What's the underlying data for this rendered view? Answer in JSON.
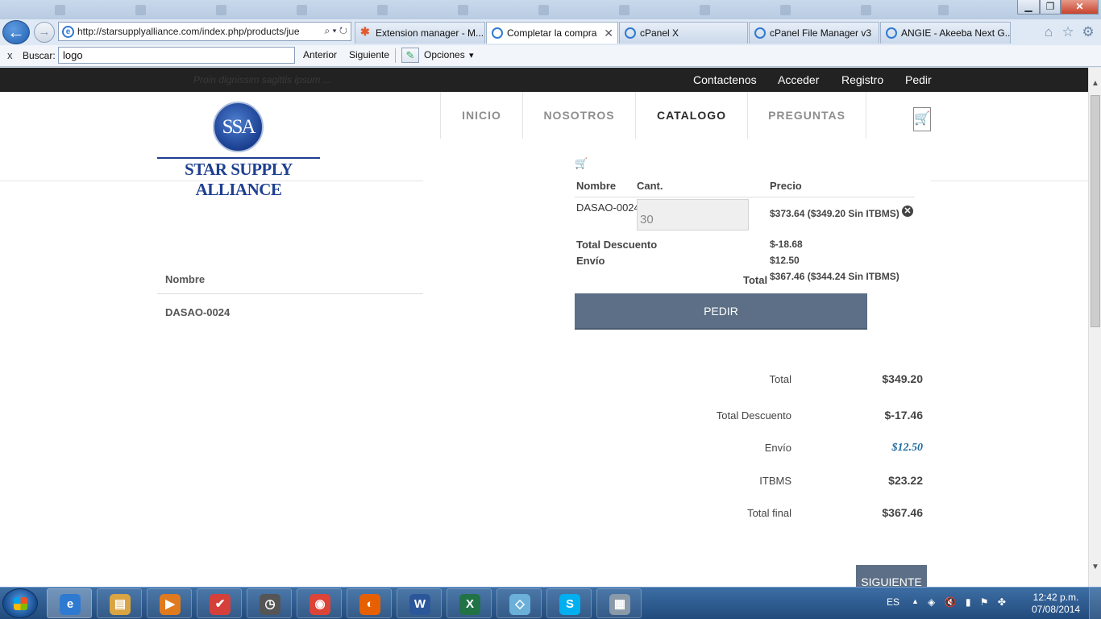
{
  "browser": {
    "address_url": "http://starsupplyalliance.com/index.php/products/jue",
    "address_tools": "⌕ ▾ ↻",
    "tabs": [
      {
        "label": "Extension manager - M...",
        "active": false
      },
      {
        "label": "Completar la compra",
        "active": true
      },
      {
        "label": "cPanel X",
        "active": false
      },
      {
        "label": "cPanel File Manager v3",
        "active": false
      },
      {
        "label": "ANGIE - Akeeba Next G...",
        "active": false
      }
    ],
    "window_buttons": {
      "minimize": "▁",
      "maximize": "❐",
      "close": "✕"
    },
    "toolbar_icons": {
      "home": "⌂",
      "favorites": "☆",
      "settings": "⚙"
    }
  },
  "findbar": {
    "close": "x",
    "label": "Buscar:",
    "value": "logo",
    "prev": "Anterior",
    "next": "Siguiente",
    "options": "Opciones",
    "options_arrow": "▾",
    "options_icon": "✎"
  },
  "site": {
    "tagline": "Proin dignissim sagittis ipsum ...",
    "top_links": [
      "Contactenos",
      "Acceder",
      "Registro",
      "Pedir"
    ],
    "logo_seal": "SSA",
    "logo_text": "STAR SUPPLY ALLIANCE",
    "nav": [
      {
        "label": "INICIO",
        "active": false
      },
      {
        "label": "NOSOTROS",
        "active": false
      },
      {
        "label": "CATALOGO",
        "active": true
      },
      {
        "label": "PREGUNTAS",
        "active": false
      }
    ],
    "cart_icon": "🛒"
  },
  "left_table": {
    "header": "Nombre",
    "rows": [
      "DASAO-0024"
    ]
  },
  "cart": {
    "icon": "🛒",
    "columns": {
      "name": "Nombre",
      "qty": "Cant.",
      "price": "Precio"
    },
    "item": {
      "name": "DASAO-0024",
      "qty": "30",
      "price": "$373.64 ($349.20 Sin ITBMS)",
      "remove_icon": "✕"
    },
    "discount_label": "Total Descuento",
    "discount_value": "$-18.68",
    "shipping_label": "Envío",
    "shipping_value": "$12.50",
    "total_label": "Total",
    "total_value": "$367.46 ($344.24 Sin ITBMS)",
    "order_button": "PEDIR"
  },
  "summary": [
    {
      "label": "Total",
      "value": "$349.20"
    },
    {
      "label": "Total Descuento",
      "value": "$-17.46"
    },
    {
      "label": "Envío",
      "value": "$12.50"
    },
    {
      "label": "ITBMS",
      "value": "$23.22"
    },
    {
      "label": "Total final",
      "value": "$367.46"
    }
  ],
  "next_button": "SIGUIENTE",
  "taskbar": {
    "apps": [
      {
        "name": "internet-explorer",
        "glyph": "e",
        "color": "#2f7ad1"
      },
      {
        "name": "file-explorer",
        "glyph": "▤",
        "color": "#d9a441"
      },
      {
        "name": "media-player",
        "glyph": "▶",
        "color": "#e07a1f"
      },
      {
        "name": "todoist",
        "glyph": "✔",
        "color": "#d6403a"
      },
      {
        "name": "clock-app",
        "glyph": "◷",
        "color": "#555555"
      },
      {
        "name": "chrome",
        "glyph": "◉",
        "color": "#db4437"
      },
      {
        "name": "firefox",
        "glyph": "◐",
        "color": "#e66000"
      },
      {
        "name": "word",
        "glyph": "W",
        "color": "#2b579a"
      },
      {
        "name": "excel",
        "glyph": "X",
        "color": "#217346"
      },
      {
        "name": "notes-app",
        "glyph": "◇",
        "color": "#6bb0d8"
      },
      {
        "name": "skype",
        "glyph": "S",
        "color": "#00aff0"
      },
      {
        "name": "calculator",
        "glyph": "▦",
        "color": "#8a9aa8"
      }
    ],
    "language": "ES",
    "tray_arrow": "▲",
    "tray_icons": "◈ 🔇 ▮ ⚑ ✤",
    "time": "12:42 p.m.",
    "date": "07/08/2014"
  },
  "colors": {
    "topbar_bg": "#222222",
    "button_bg": "#5c6f86",
    "shipping_value": "#1f6a9c",
    "brand_blue": "#1e3f91"
  }
}
